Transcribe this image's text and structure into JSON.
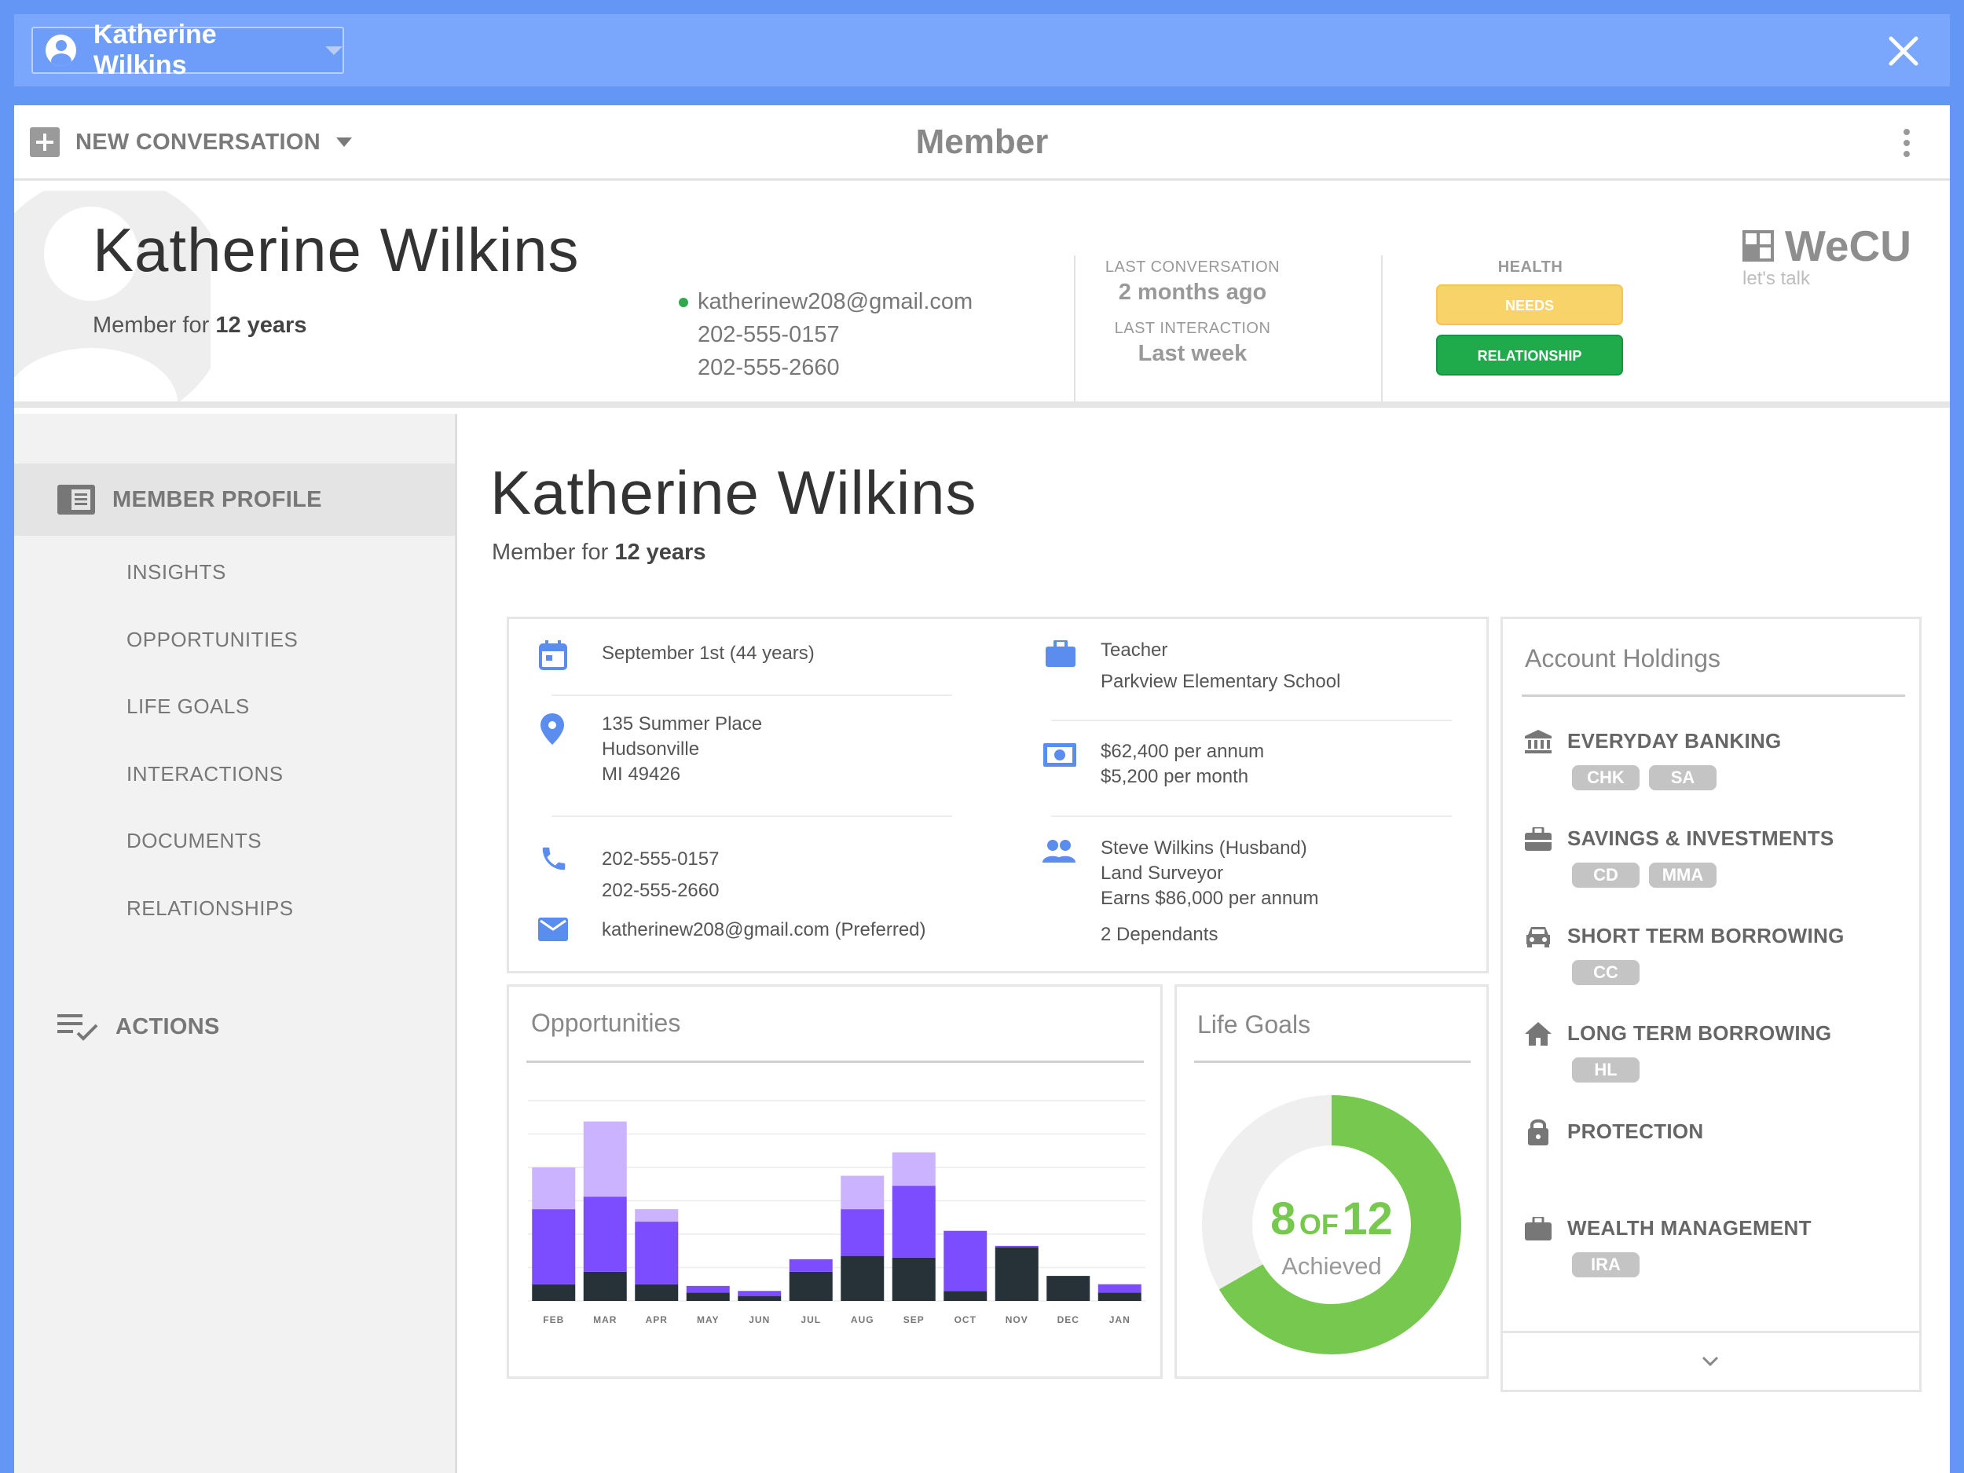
{
  "topbar": {
    "member_name": "Katherine Wilkins"
  },
  "header": {
    "new_conversation_label": "NEW CONVERSATION",
    "title": "Member"
  },
  "summary": {
    "name": "Katherine Wilkins",
    "tenure_prefix": "Member for ",
    "tenure_value": "12 years",
    "email": "katherinew208@gmail.com",
    "phone_1": "202-555-0157",
    "phone_2": "202-555-2660",
    "last_conversation_label": "LAST CONVERSATION",
    "last_conversation_value": "2 months ago",
    "last_interaction_label": "LAST INTERACTION",
    "last_interaction_value": "Last week",
    "health_label": "HEALTH",
    "health_needs": "NEEDS",
    "health_relationship": "RELATIONSHIP",
    "brand_name": "WeCU",
    "brand_tagline": "let's talk"
  },
  "sidebar": {
    "member_profile": "MEMBER PROFILE",
    "items": [
      "INSIGHTS",
      "OPPORTUNITIES",
      "LIFE GOALS",
      "INTERACTIONS",
      "DOCUMENTS",
      "RELATIONSHIPS"
    ],
    "actions": "ACTIONS"
  },
  "profile": {
    "name": "Katherine Wilkins",
    "tenure_prefix": "Member for ",
    "tenure_value": "12 years",
    "birthday": "September 1st (44 years)",
    "address_1": "135 Summer Place",
    "address_2": "Hudsonville",
    "address_3": "MI 49426",
    "phone_1": "202-555-0157",
    "phone_2": "202-555-2660",
    "email": "katherinew208@gmail.com (Preferred)",
    "occupation": "Teacher",
    "employer": "Parkview Elementary School",
    "income_annual": "$62,400 per annum",
    "income_monthly": "$5,200 per month",
    "spouse": "Steve Wilkins (Husband)",
    "spouse_job": "Land Surveyor",
    "spouse_income": "Earns $86,000 per annum",
    "dependants": "2 Dependants"
  },
  "holdings": {
    "title": "Account Holdings",
    "categories": [
      {
        "icon": "bank-icon",
        "label": "EVERYDAY BANKING",
        "tags": [
          "CHK",
          "SA"
        ]
      },
      {
        "icon": "briefcase-icon",
        "label": "SAVINGS & INVESTMENTS",
        "tags": [
          "CD",
          "MMA"
        ]
      },
      {
        "icon": "car-icon",
        "label": "SHORT TERM BORROWING",
        "tags": [
          "CC"
        ]
      },
      {
        "icon": "home-icon",
        "label": "LONG TERM BORROWING",
        "tags": [
          "HL"
        ]
      },
      {
        "icon": "lock-icon",
        "label": "PROTECTION",
        "tags": []
      },
      {
        "icon": "briefcase-icon",
        "label": "WEALTH MANAGEMENT",
        "tags": [
          "IRA"
        ]
      }
    ]
  },
  "opportunities": {
    "title": "Opportunities"
  },
  "goals": {
    "title": "Life Goals",
    "achieved": "8",
    "of_label": "OF",
    "total": "12",
    "caption": "Achieved"
  },
  "colors": {
    "accent": "#6496f5",
    "needs": "#f7d36a",
    "relationship": "#1fab4c",
    "goal": "#76c94e"
  },
  "chart_data": {
    "type": "bar",
    "stacked": true,
    "categories": [
      "FEB",
      "MAR",
      "APR",
      "MAY",
      "JUN",
      "JUL",
      "AUG",
      "SEP",
      "OCT",
      "NOV",
      "DEC",
      "JAN"
    ],
    "series": [
      {
        "values": [
          2,
          3.5,
          2,
          1,
          0.6,
          3.5,
          5.4,
          5.2,
          1.2,
          6.4,
          3,
          1
        ]
      },
      {
        "values": [
          9,
          9,
          7.5,
          0.8,
          0.6,
          1.5,
          5.6,
          8.6,
          7.2,
          0.2,
          0,
          1
        ]
      },
      {
        "values": [
          5,
          9,
          1.5,
          0,
          0,
          0,
          4,
          4,
          0,
          0,
          0,
          0
        ]
      }
    ],
    "series_colors": [
      "#263238",
      "#7c4dff",
      "#ccb3ff"
    ],
    "ylim": [
      0,
      24
    ],
    "grid": true
  }
}
